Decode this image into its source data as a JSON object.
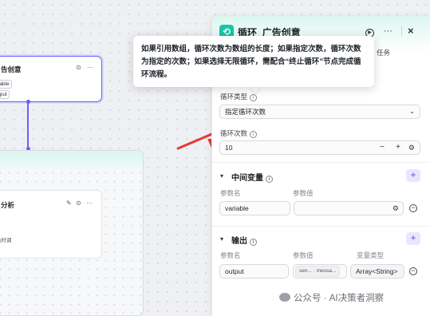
{
  "canvas": {
    "node_top": {
      "title": "告创意",
      "chip1": "iable",
      "chip2": "tput",
      "icons": [
        "target-icon",
        "more-icon"
      ]
    },
    "node_bottom": {
      "title": "分析",
      "sub": "色时调",
      "icons": [
        "edit-icon",
        "target-icon",
        "more-icon"
      ]
    }
  },
  "tooltip": {
    "text": "如果引用数组，循环次数为数组的长度；如果指定次数，循环次数为指定的次数；如果选择无限循环，需配合“终止循环”节点完成循环流程。"
  },
  "panel": {
    "title": "循环_广告创意",
    "tab_fragment": "任务",
    "close_symbol": "×",
    "more_symbol": "···",
    "run_symbol": "▶",
    "loop_type": {
      "label": "循环类型",
      "value": "指定循环次数"
    },
    "loop_count": {
      "label": "循环次数",
      "value": "10",
      "minus": "−",
      "plus": "+"
    },
    "intermediate": {
      "title": "中间变量",
      "col_name": "参数名",
      "col_value": "参数值",
      "rows": [
        {
          "name": "variable",
          "value": ""
        }
      ]
    },
    "output": {
      "title": "输出",
      "col_name": "参数名",
      "col_value": "参数值",
      "col_type": "变量类型",
      "rows": [
        {
          "name": "output",
          "value_ref": "sen...",
          "value_ref2": "messa...",
          "type": "Array<String>"
        }
      ]
    }
  },
  "watermark": {
    "text": "公众号 · AI决策者洞察"
  },
  "colors": {
    "accent": "#6b5bff",
    "brand": "#19c5a4",
    "arrow": "#e53935"
  }
}
